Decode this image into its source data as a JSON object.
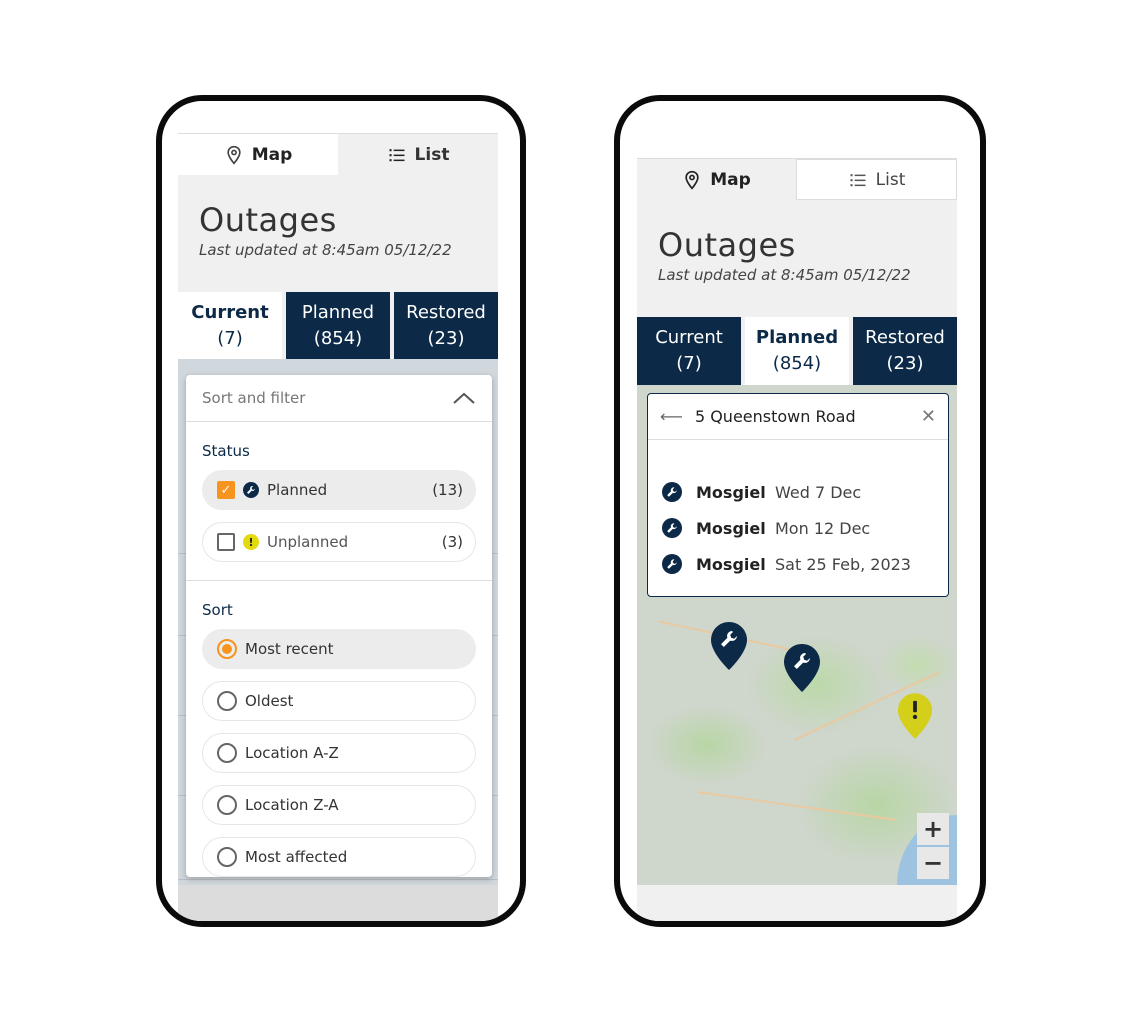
{
  "left": {
    "view_tabs": {
      "map": "Map",
      "list": "List"
    },
    "title": "Outages",
    "updated": "Last updated at 8:45am 05/12/22",
    "status_tabs": [
      {
        "label": "Current",
        "count": "(7)"
      },
      {
        "label": "Planned",
        "count": "(854)"
      },
      {
        "label": "Restored",
        "count": "(23)"
      }
    ],
    "filter": {
      "header": "Sort and filter",
      "status_label": "Status",
      "status_options": [
        {
          "label": "Planned",
          "count": "(13)",
          "checked": true,
          "icon": "wrench-icon"
        },
        {
          "label": "Unplanned",
          "count": "(3)",
          "checked": false,
          "icon": "warning-icon"
        }
      ],
      "sort_label": "Sort",
      "sort_options": [
        "Most recent",
        "Oldest",
        "Location A-Z",
        "Location Z-A",
        "Most affected"
      ],
      "sort_selected": "Most recent"
    }
  },
  "right": {
    "view_tabs": {
      "map": "Map",
      "list": "List"
    },
    "title": "Outages",
    "updated": "Last updated at 8:45am  05/12/22",
    "status_tabs": [
      {
        "label": "Current",
        "count": "(7)"
      },
      {
        "label": "Planned",
        "count": "(854)"
      },
      {
        "label": "Restored",
        "count": "(23)"
      }
    ],
    "popup": {
      "address": "5 Queenstown Road",
      "rows": [
        {
          "location": "Mosgiel",
          "date": "Wed 7 Dec"
        },
        {
          "location": "Mosgiel",
          "date": "Mon 12 Dec"
        },
        {
          "location": "Mosgiel",
          "date": "Sat 25 Feb, 2023"
        }
      ]
    },
    "zoom_in": "+",
    "zoom_out": "−"
  },
  "colors": {
    "navy": "#0c2a47",
    "orange": "#f7931e",
    "yellow": "#e3d90f"
  }
}
